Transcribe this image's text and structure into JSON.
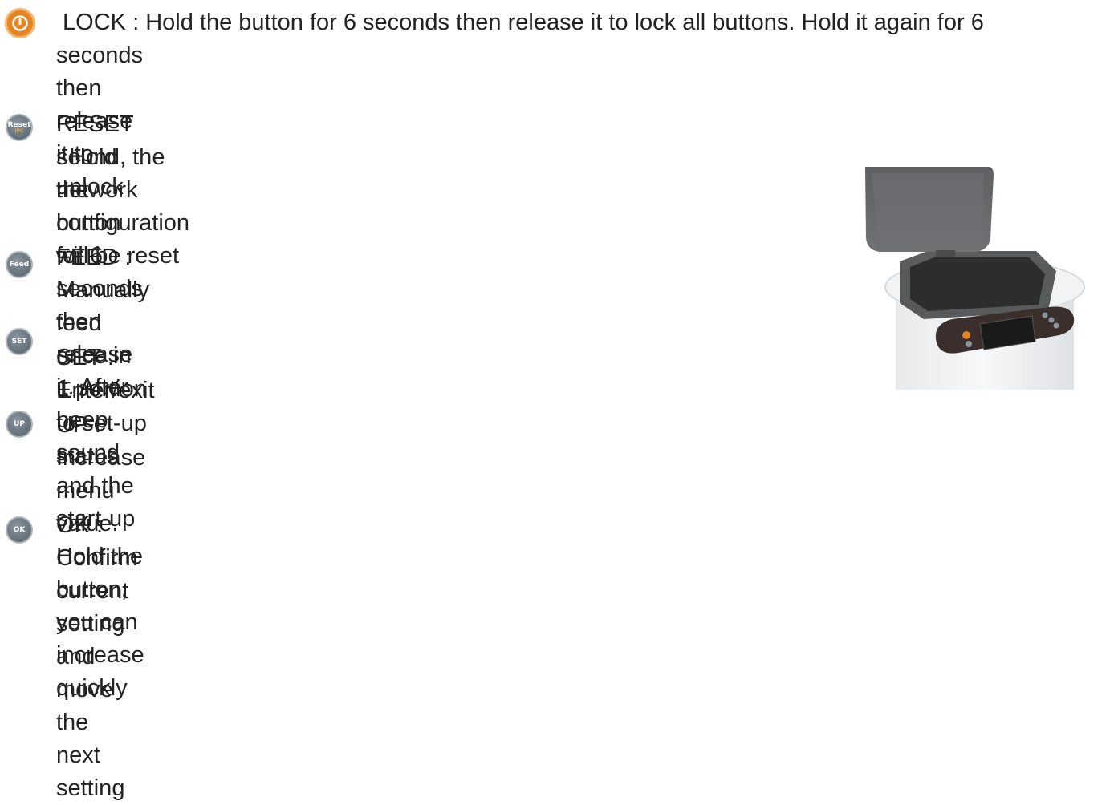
{
  "items": [
    {
      "name": "lock",
      "icon": "lock-power-icon",
      "line1": " LOCK : Hold the button for 6 seconds then release it to lock all buttons. Hold it again for 6",
      "line2": "seconds then release it to unlock"
    },
    {
      "name": "reset",
      "icon": "reset-button-icon",
      "icon_label": "Reset",
      "icon_sublabel": "IPC",
      "line1": "RESET : Hold the button for 6 seconds then release it. After beep sound and the start-up",
      "line2": "sound, the network configuration will be reset"
    },
    {
      "name": "feed",
      "icon": "feed-button-icon",
      "icon_label": "Feed",
      "line1": "FEED : Manually feed once in 1 portion"
    },
    {
      "name": "set",
      "icon": "set-button-icon",
      "icon_label": "SET",
      "line1": "SET : Enter/exit to set-up status"
    },
    {
      "name": "up",
      "icon": "up-button-icon",
      "icon_label": "UP",
      "line1": "UP : Increase menu value. Hold the button, you can increase quickly"
    },
    {
      "name": "ok",
      "icon": "ok-button-icon",
      "icon_label": "OK",
      "line1": "OK : Confirm current setting and move the next setting"
    }
  ],
  "colors": {
    "lock_orange": "#e68422",
    "button_grey": "#6b7781",
    "text": "#222222"
  },
  "image": {
    "icon": "pet-feeder-device-image"
  }
}
